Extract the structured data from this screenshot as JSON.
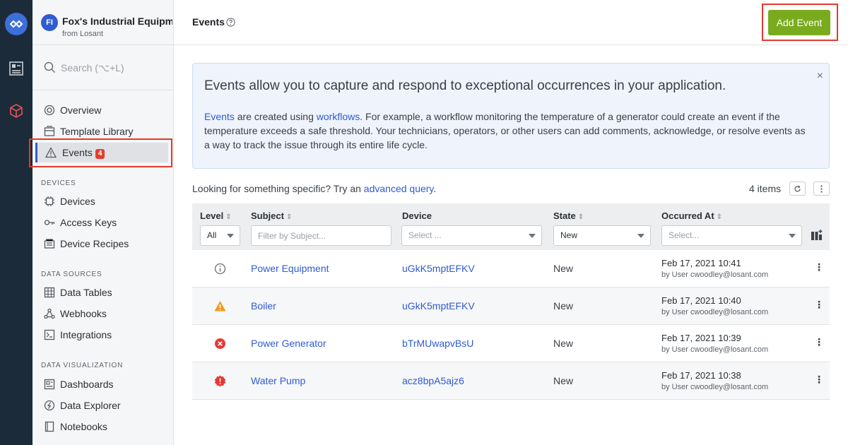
{
  "sidebar": {
    "app_avatar": "FI",
    "app_name": "Fox's Industrial Equipm...",
    "app_sub": "from Losant",
    "search_placeholder": "Search (⌥+L)",
    "items": [
      {
        "label": "Overview",
        "icon": "overview-icon"
      },
      {
        "label": "Template Library",
        "icon": "template-library-icon"
      },
      {
        "label": "Events",
        "icon": "warning-icon",
        "badge": "4",
        "active": true
      }
    ],
    "sections": [
      {
        "title": "DEVICES",
        "items": [
          {
            "label": "Devices",
            "icon": "chip-icon"
          },
          {
            "label": "Access Keys",
            "icon": "key-icon"
          },
          {
            "label": "Device Recipes",
            "icon": "recipe-icon"
          }
        ]
      },
      {
        "title": "DATA SOURCES",
        "items": [
          {
            "label": "Data Tables",
            "icon": "table-icon"
          },
          {
            "label": "Webhooks",
            "icon": "webhook-icon"
          },
          {
            "label": "Integrations",
            "icon": "integration-icon"
          }
        ]
      },
      {
        "title": "DATA VISUALIZATION",
        "items": [
          {
            "label": "Dashboards",
            "icon": "dashboard-icon"
          },
          {
            "label": "Data Explorer",
            "icon": "data-explorer-icon"
          },
          {
            "label": "Notebooks",
            "icon": "notebook-icon"
          }
        ]
      }
    ]
  },
  "header": {
    "title": "Events",
    "add_label": "Add Event"
  },
  "info": {
    "headline": "Events allow you to capture and respond to exceptional occurrences in your application.",
    "link1": "Events",
    "text1": " are created using ",
    "link2": "workflows",
    "text2": ". For example, a workflow monitoring the temperature of a generator could create an event if the temperature exceeds a safe threshold. Your technicians, operators, or other users can add comments, acknowledge, or resolve events as a way to track the issue through its entire life cycle.",
    "close": "×"
  },
  "query": {
    "prefix": "Looking for something specific? Try an ",
    "link": "advanced query",
    "suffix": "."
  },
  "items_count": "4 items",
  "table": {
    "columns": {
      "level": "Level",
      "subject": "Subject",
      "device": "Device",
      "state": "State",
      "occurred": "Occurred At"
    },
    "filters": {
      "level": "All",
      "subject_placeholder": "Filter by Subject...",
      "device_placeholder": "Select ...",
      "state": "New",
      "occurred_placeholder": "Select..."
    },
    "rows": [
      {
        "level": "info",
        "subject": "Power Equipment",
        "device": "uGkK5mptEFKV",
        "state": "New",
        "date": "Feb 17, 2021 10:41",
        "by": "by User cwoodley@losant.com"
      },
      {
        "level": "warning",
        "subject": "Boiler",
        "device": "uGkK5mptEFKV",
        "state": "New",
        "date": "Feb 17, 2021 10:40",
        "by": "by User cwoodley@losant.com"
      },
      {
        "level": "error",
        "subject": "Power Generator",
        "device": "bTrMUwapvBsU",
        "state": "New",
        "date": "Feb 17, 2021 10:39",
        "by": "by User cwoodley@losant.com"
      },
      {
        "level": "critical",
        "subject": "Water Pump",
        "device": "acz8bpA5ajz6",
        "state": "New",
        "date": "Feb 17, 2021 10:38",
        "by": "by User cwoodley@losant.com"
      }
    ]
  },
  "colors": {
    "accent": "#2f5bd3",
    "add_button": "#7aab1e",
    "highlight": "#e33a2b",
    "warning": "#f29a1f",
    "error": "#e53935"
  }
}
